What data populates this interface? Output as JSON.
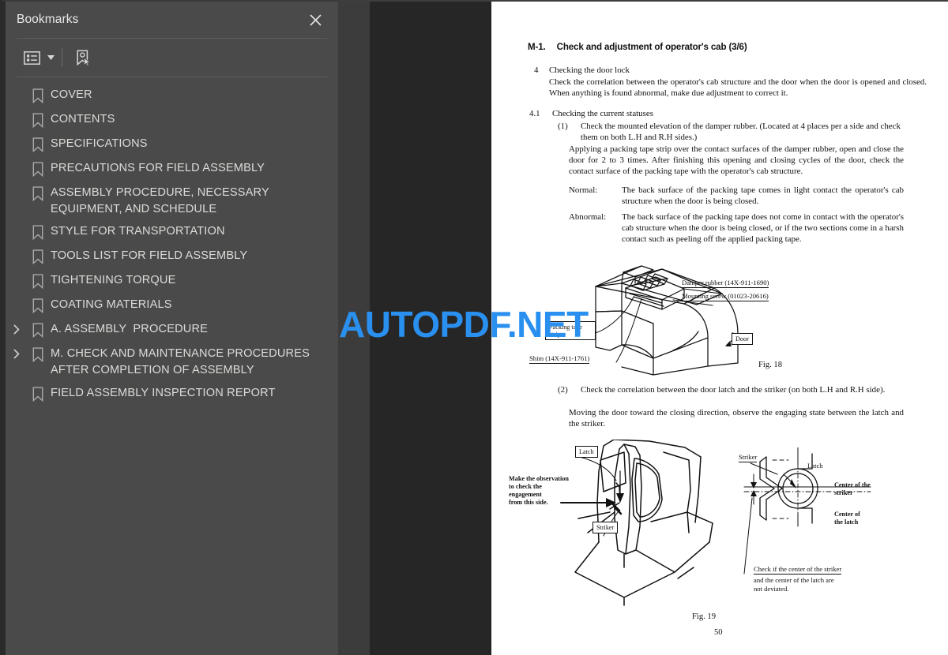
{
  "panel": {
    "title": "Bookmarks",
    "close_icon": "close-icon",
    "toolbar": {
      "list_options_icon": "bookmark-list-options-icon",
      "caret_icon": "chevron-down-icon",
      "new_bookmark_icon": "new-bookmark-icon"
    },
    "items": [
      {
        "label": "COVER",
        "expandable": false
      },
      {
        "label": "CONTENTS",
        "expandable": false
      },
      {
        "label": "SPECIFICATIONS",
        "expandable": false
      },
      {
        "label": "PRECAUTIONS FOR FIELD ASSEMBLY",
        "expandable": false
      },
      {
        "label": "ASSEMBLY PROCEDURE, NECESSARY EQUIPMENT, AND SCHEDULE",
        "expandable": false
      },
      {
        "label": "STYLE FOR TRANSPORTATION",
        "expandable": false
      },
      {
        "label": "TOOLS LIST FOR FIELD ASSEMBLY",
        "expandable": false
      },
      {
        "label": "TIGHTENING TORQUE",
        "expandable": false
      },
      {
        "label": "COATING MATERIALS",
        "expandable": false
      },
      {
        "label": "A. ASSEMBLY  PROCEDURE",
        "expandable": true
      },
      {
        "label": "M. CHECK AND MAINTENANCE PROCEDURES AFTER COMPLETION OF ASSEMBLY",
        "expandable": true
      },
      {
        "label": "FIELD ASSEMBLY INSPECTION REPORT",
        "expandable": false
      }
    ]
  },
  "watermark": {
    "text": "AUTOPDF.NET",
    "color": "#2a90f0"
  },
  "document": {
    "title_number": "M-1.",
    "title_text": "Check and adjustment of operator's cab (3/6)",
    "sections": [
      {
        "marker": "4",
        "heading": "Checking the door lock",
        "body": "Check the correlation between the operator's cab structure and the door when the door is opened and closed.   When anything is found abnormal, make due adjustment to correct it."
      },
      {
        "marker": "4.1",
        "heading": "Checking the current statuses"
      }
    ],
    "item1_marker": "(1)",
    "item1_text": "Check the mounted elevation of the damper rubber. (Located at 4 places per a side and check them on both L.H and R.H sides.)",
    "item1_para": "Applying a packing tape strip over the contact surfaces of the damper rubber, open and close the door for 2 to 3 times.   After finishing this opening and closing cycles of the door, check the contact surface of the packing tape with the operator's cab structure.",
    "normal_label": "Normal:",
    "normal_text": "The back surface of the packing tape comes in light contact the operator's cab structure when the door is being closed.",
    "abnormal_label": "Abnormal:",
    "abnormal_text": "The back surface of the packing tape does not come in contact with the operator's cab structure when the door is being closed, or if the two sections come in a harsh contact such as peeling off the applied packing tape.",
    "item2_marker": "(2)",
    "item2_text": "Check the correlation between the door latch and the striker (on both L.H and R.H side).",
    "item2_para": "Moving the door toward the closing direction, observe the engaging state between the latch and the striker.",
    "figure18": {
      "caption": "Fig. 18",
      "labels": {
        "damper_rubber": "Damper rubber (14X-911-1690)",
        "mounting_screw": "Mounting screw (01023-20616)",
        "packing_tape": "Packing tape\nstrip",
        "door": "Door",
        "shim": "Shim (14X-911-1761)"
      }
    },
    "figure19": {
      "caption": "Fig. 19",
      "labels": {
        "latch_left": "Latch",
        "observation_note": "Make the observation\nto check the\nengagement\nfrom this side.",
        "striker_left": "Striker",
        "striker_right": "Striker",
        "latch_right": "Latch",
        "center_of_striker": "Center of the\nstriker",
        "center_of_latch": "Center of\nthe latch",
        "check_note_underlined": "Check if the center of the striker",
        "check_note_rest": "and the center of the latch are\nnot deviated."
      }
    },
    "page_number": "50"
  }
}
